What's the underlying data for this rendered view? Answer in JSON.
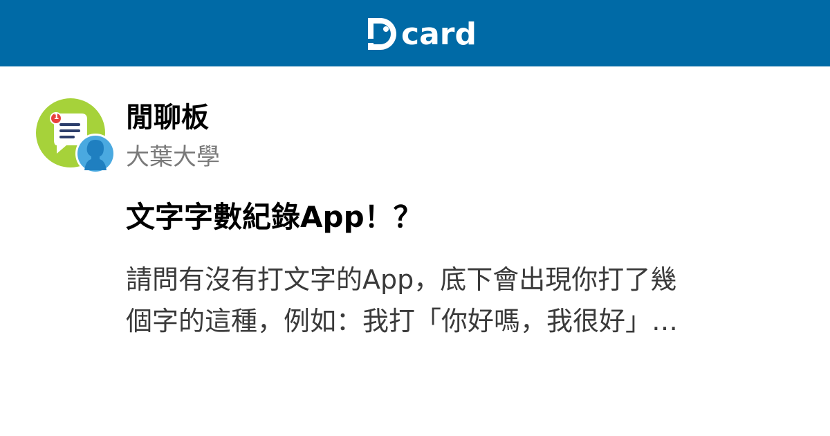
{
  "header": {
    "logo_text": "card",
    "background_color": "#006aa6"
  },
  "forum": {
    "name": "閒聊板",
    "school": "大葉大學",
    "notification_count": "1",
    "icon": "chat-bubble-icon",
    "user_icon": "user-avatar-icon"
  },
  "post": {
    "title": "文字字數紀錄App！？",
    "excerpt": "請問有沒有打文字的App，底下會出現你打了幾\n個字的這種，例如：我打「你好嗎，我很好」…"
  },
  "colors": {
    "brand": "#006aa6",
    "forum_icon_green": "#a6d23a",
    "notification_red": "#e8413c",
    "avatar_blue": "#4aa9e0"
  }
}
